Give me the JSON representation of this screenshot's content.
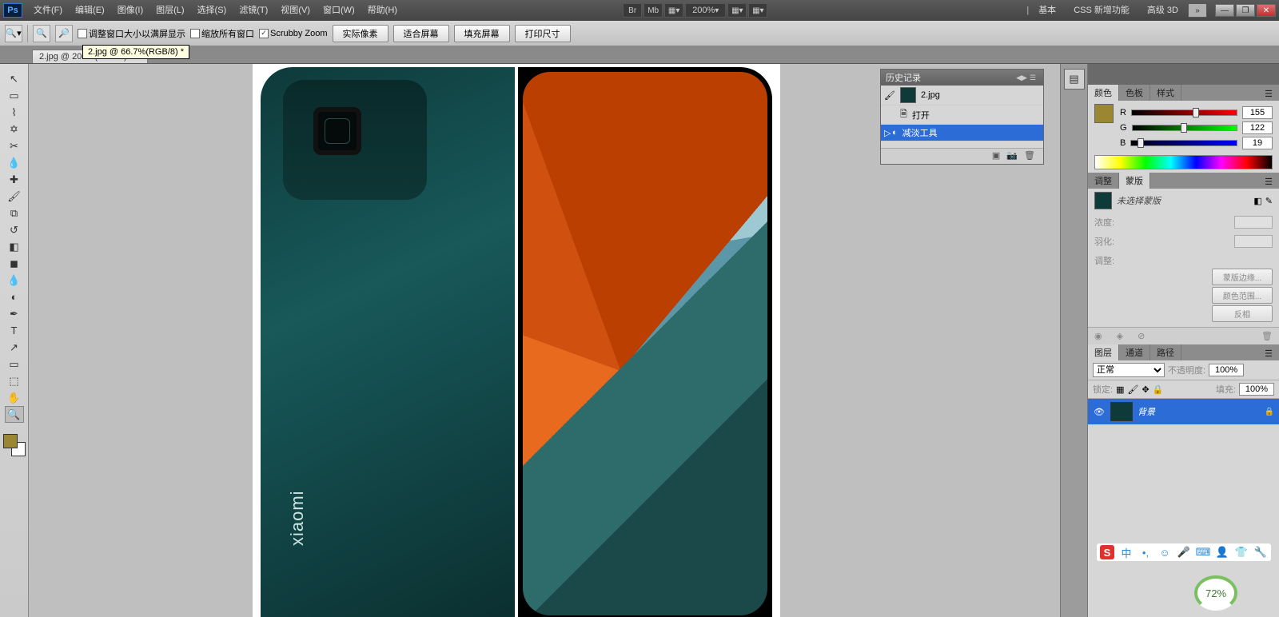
{
  "menubar": {
    "logo": "Ps",
    "items": [
      "文件(F)",
      "编辑(E)",
      "图像(I)",
      "图层(L)",
      "选择(S)",
      "滤镜(T)",
      "视图(V)",
      "窗口(W)",
      "帮助(H)"
    ],
    "iconbtns": [
      "Br",
      "Mb",
      "▦▾"
    ],
    "zoom": "200%",
    "tabs": [
      "基本",
      "CSS 新增功能",
      "高级 3D"
    ],
    "expand": "»"
  },
  "optbar": {
    "chk1": "调整窗口大小以满屏显示",
    "chk2": "缩放所有窗口",
    "chk3": "Scrubby Zoom",
    "btns": [
      "实际像素",
      "适合屏幕",
      "填充屏幕",
      "打印尺寸"
    ]
  },
  "tooltip": "2.jpg @ 66.7%(RGB/8) *",
  "doctab": "2.jpg @ 200%(RGB/8) *",
  "history": {
    "title": "历史记录",
    "file": "2.jpg",
    "steps": [
      "打开",
      "减淡工具"
    ]
  },
  "color": {
    "tabs": [
      "颜色",
      "色板",
      "样式"
    ],
    "r_lbl": "R",
    "r_val": "155",
    "g_lbl": "G",
    "g_val": "122",
    "b_lbl": "B",
    "b_val": "19"
  },
  "mask": {
    "tabs": [
      "调整",
      "蒙版"
    ],
    "sel_label": "未选择蒙版",
    "density": "浓度:",
    "feather": "羽化:",
    "adjust": "调整:",
    "btns": [
      "蒙版边缘...",
      "颜色范围...",
      "反相"
    ]
  },
  "layers": {
    "tabs": [
      "图层",
      "通道",
      "路径"
    ],
    "blend": "正常",
    "opacity_lbl": "不透明度:",
    "opacity_val": "100%",
    "lock_lbl": "锁定:",
    "fill_lbl": "填充:",
    "fill_val": "100%",
    "layer_name": "背景"
  },
  "ime": {
    "s": "S",
    "zh": "中"
  },
  "gauge": "72%",
  "brand": "xiaomi"
}
